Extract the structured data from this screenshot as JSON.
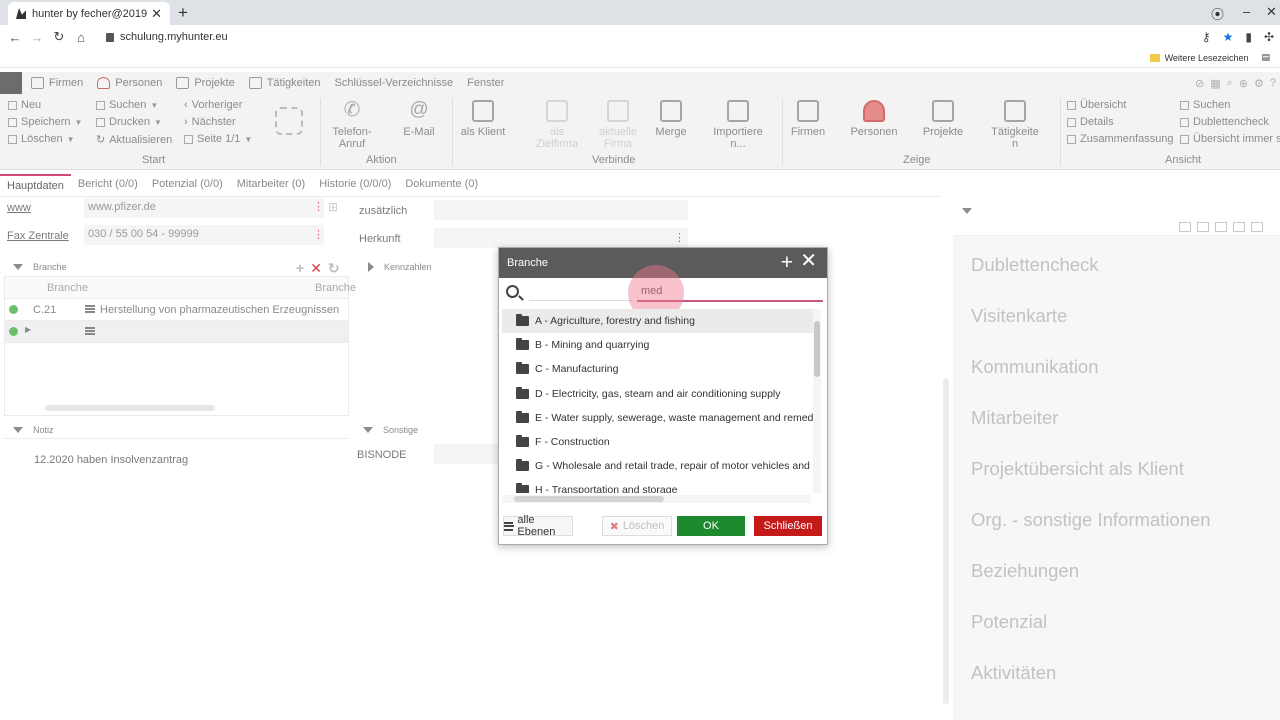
{
  "browser": {
    "tab_title": "hunter by fecher@2019",
    "url": "schulung.myhunter.eu",
    "bookmark": "Weitere Lesezeichen"
  },
  "menu": {
    "items": [
      "Firmen",
      "Personen",
      "Projekte",
      "Tätigkeiten",
      "Schlüssel-Verzeichnisse",
      "Fenster"
    ]
  },
  "ribbon": {
    "start": {
      "new": "Neu",
      "save": "Speichern",
      "delete": "Löschen",
      "search": "Suchen",
      "print": "Drucken",
      "refresh": "Aktualisieren",
      "prev": "Vorheriger",
      "next": "Nächster",
      "page": "Seite 1/1",
      "label": "Start"
    },
    "aktion": {
      "phone": "Telefon-\nAnruf",
      "email": "E-Mail",
      "label": "Aktion"
    },
    "verbinde": {
      "client": "als Klient",
      "target": "als\nZielfirma",
      "current": "aktuelle\nFirma",
      "merge": "Merge",
      "import": "Importiere\nn...",
      "label": "Verbinde"
    },
    "zeige": {
      "firms": "Firmen",
      "persons": "Personen",
      "projects": "Projekte",
      "activities": "Tätigkeite\nn",
      "label": "Zeige"
    },
    "ansicht": {
      "overview": "Übersicht",
      "details": "Details",
      "summary": "Zusammenfassung",
      "search": "Suchen",
      "dupcheck": "Dublettencheck",
      "always": "Übersicht immer s",
      "label": "Ansicht"
    }
  },
  "subtabs": [
    "Hauptdaten",
    "Bericht (0/0)",
    "Potenzial (0/0)",
    "Mitarbeiter (0)",
    "Historie (0/0/0)",
    "Dokumente (0)"
  ],
  "form": {
    "www_label": "www",
    "www_value": "www.pfizer.de",
    "fax_label": "Fax Zentrale",
    "fax_value": "030 / 55 00 54 - 99999",
    "extra_label": "zusätzlich",
    "origin_label": "Herkunft",
    "branche_section": "Branche",
    "branche_col": "Branche",
    "branche_col2": "Branche",
    "branche_code": "C.21",
    "branche_text": "Herstellung von pharmazeutischen Erzeugnissen",
    "kennzahlen_section": "Kennzahlen",
    "notiz_section": "Notiz",
    "notiz_text": "12.2020 haben Insolvenzantrag",
    "sonstige_section": "Sonstige",
    "bisnode_label": "BISNODE"
  },
  "right_panel": {
    "items": [
      "Dublettencheck",
      "Visitenkarte",
      "Kommunikation",
      "Mitarbeiter",
      "Projektübersicht als Klient",
      "Org. - sonstige Informationen",
      "Beziehungen",
      "Potenzial",
      "Aktivitäten"
    ]
  },
  "dialog": {
    "title": "Branche",
    "search_value": "med",
    "tree": [
      "A - Agriculture, forestry and fishing",
      "B - Mining and quarrying",
      "C - Manufacturing",
      "D - Electricity, gas, steam and air conditioning supply",
      "E - Water supply, sewerage, waste management and remediat",
      "F - Construction",
      "G - Wholesale and retail trade, repair of motor vehicles and m",
      "H - Transportation and storage"
    ],
    "btn_levels": "alle Ebenen",
    "btn_delete": "Löschen",
    "btn_ok": "OK",
    "btn_close": "Schließen"
  }
}
